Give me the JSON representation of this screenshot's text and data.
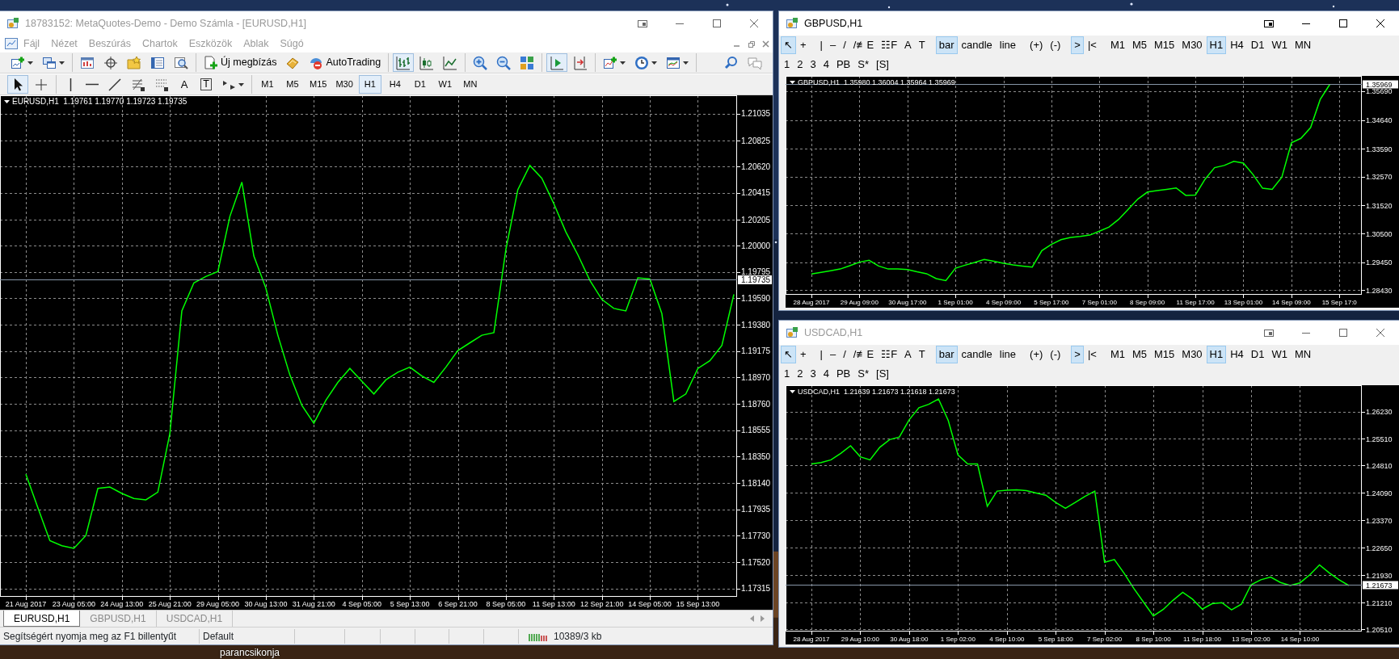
{
  "desktop": {
    "label": "parancsikonja"
  },
  "windows": [
    {
      "kind": "terminal",
      "title": "18783152: MetaQuotes-Demo - Demo Számla - [EURUSD,H1]",
      "active": false,
      "menu": [
        "Fájl",
        "Nézet",
        "Beszúrás",
        "Chartok",
        "Eszközök",
        "Ablak",
        "Súgó"
      ],
      "toolbar": {
        "groups": [
          [
            {
              "kind": "new-chart",
              "on": false,
              "dropdown": true
            },
            {
              "kind": "profiles",
              "on": false,
              "dropdown": true
            }
          ],
          [
            {
              "kind": "market-watch",
              "on": false,
              "dropdown": false
            },
            {
              "kind": "data-window",
              "on": false,
              "dropdown": false
            },
            {
              "kind": "navigator",
              "on": false,
              "dropdown": false
            },
            {
              "kind": "terminal",
              "on": false,
              "dropdown": false
            },
            {
              "kind": "tester",
              "on": false,
              "dropdown": false
            }
          ],
          [
            {
              "kind": "new-order",
              "label": "Új megbízás",
              "on": false,
              "dropdown": false
            },
            {
              "kind": "metaeditor",
              "on": false,
              "dropdown": false
            },
            {
              "kind": "autotrading",
              "label": "AutoTrading",
              "on": false,
              "dropdown": false
            }
          ],
          [
            {
              "kind": "bar-chart",
              "on": true,
              "dropdown": false
            },
            {
              "kind": "candle-chart",
              "on": false,
              "dropdown": false
            },
            {
              "kind": "line-chart",
              "on": false,
              "dropdown": false
            }
          ],
          [
            {
              "kind": "zoom-in",
              "on": false,
              "dropdown": false
            },
            {
              "kind": "zoom-out",
              "on": false,
              "dropdown": false
            },
            {
              "kind": "tile",
              "on": false,
              "dropdown": false
            }
          ],
          [
            {
              "kind": "auto-scroll",
              "on": true,
              "dropdown": false
            },
            {
              "kind": "chart-shift",
              "on": false,
              "dropdown": false
            }
          ],
          [
            {
              "kind": "indicators",
              "on": false,
              "dropdown": true
            },
            {
              "kind": "periods",
              "on": false,
              "dropdown": true
            },
            {
              "kind": "templates",
              "on": false,
              "dropdown": true
            }
          ]
        ],
        "right": [
          {
            "kind": "search",
            "on": false,
            "dropdown": false
          },
          {
            "kind": "chat",
            "on": false,
            "dropdown": false
          }
        ]
      },
      "drawing_tools": {
        "groups": [
          [
            {
              "kind": "cursor",
              "on": true,
              "dropdown": false
            },
            {
              "kind": "crosshair",
              "on": false,
              "dropdown": false
            }
          ],
          [
            {
              "kind": "vline",
              "on": false,
              "dropdown": false
            },
            {
              "kind": "hline",
              "on": false,
              "dropdown": false
            },
            {
              "kind": "trendline",
              "on": false,
              "dropdown": false
            },
            {
              "kind": "fibo-e",
              "on": false,
              "dropdown": false
            },
            {
              "kind": "fibo-f",
              "on": false,
              "dropdown": false
            },
            {
              "kind": "letter",
              "label": "A",
              "on": false,
              "dropdown": false
            },
            {
              "kind": "boxed-letter",
              "label": "T",
              "on": false,
              "dropdown": false
            },
            {
              "kind": "arrows",
              "on": false,
              "dropdown": true
            }
          ],
          [
            {
              "kind": "timeframe",
              "label": "M1",
              "on": false,
              "dropdown": false
            },
            {
              "kind": "timeframe",
              "label": "M5",
              "on": false,
              "dropdown": false
            },
            {
              "kind": "timeframe",
              "label": "M15",
              "on": false,
              "dropdown": false
            },
            {
              "kind": "timeframe",
              "label": "M30",
              "on": false,
              "dropdown": false
            },
            {
              "kind": "timeframe",
              "label": "H1",
              "on": true,
              "dropdown": false
            },
            {
              "kind": "timeframe",
              "label": "H4",
              "on": false,
              "dropdown": false
            },
            {
              "kind": "timeframe",
              "label": "D1",
              "on": false,
              "dropdown": false
            },
            {
              "kind": "timeframe",
              "label": "W1",
              "on": false,
              "dropdown": false
            },
            {
              "kind": "timeframe",
              "label": "MN",
              "on": false,
              "dropdown": false
            }
          ]
        ]
      },
      "chart": {
        "chart_data": {
          "type": "line",
          "title": "EURUSD,H1  1.19761 1.19770 1.19723 1.19735",
          "categories": [
            "21 Aug 2017",
            null,
            null,
            null,
            "23 Aug 05:00",
            null,
            null,
            null,
            "24 Aug 13:00",
            null,
            null,
            null,
            "25 Aug 21:00",
            null,
            null,
            null,
            "29 Aug 05:00",
            null,
            null,
            null,
            "30 Aug 13:00",
            null,
            null,
            null,
            "31 Aug 21:00",
            null,
            null,
            null,
            "4 Sep 05:00",
            null,
            null,
            null,
            "5 Sep 13:00",
            null,
            null,
            null,
            "6 Sep 21:00",
            null,
            null,
            null,
            "8 Sep 05:00",
            null,
            null,
            null,
            "11 Sep 13:00",
            null,
            null,
            null,
            "12 Sep 21:00",
            null,
            null,
            null,
            "14 Sep 05:00",
            null,
            null,
            null,
            "15 Sep 13:00",
            null,
            null,
            null
          ],
          "series": [
            {
              "color": "#00ff00",
              "values": [
                1.1821,
                1.1795,
                1.1769,
                1.1765,
                1.1763,
                1.1773,
                1.181,
                1.1811,
                1.1806,
                1.1802,
                1.1801,
                1.1807,
                1.1853,
                1.1949,
                1.1971,
                1.1976,
                1.198,
                1.2023,
                1.205,
                1.1992,
                1.1967,
                1.193,
                1.1899,
                1.1875,
                1.1861,
                1.1879,
                1.1893,
                1.1904,
                1.1894,
                1.1884,
                1.1895,
                1.1901,
                1.1905,
                1.1898,
                1.1893,
                1.1905,
                1.1918,
                1.1924,
                1.193,
                1.1932,
                1.1997,
                1.2044,
                1.2063,
                1.2053,
                1.2033,
                1.2011,
                1.1993,
                1.1973,
                1.1958,
                1.1951,
                1.1949,
                1.1975,
                1.1974,
                1.1947,
                1.1878,
                1.1884,
                1.1904,
                1.191,
                1.1922,
                1.1962
              ]
            }
          ],
          "grid": true,
          "ylim": [
            1.1725,
            1.2118
          ],
          "yticks": [
            {
              "value": 1.21035,
              "label": "1.21035"
            },
            {
              "value": 1.20825,
              "label": "1.20825"
            },
            {
              "value": 1.2062,
              "label": "1.20620"
            },
            {
              "value": 1.20415,
              "label": "1.20415"
            },
            {
              "value": 1.20205,
              "label": "1.20205"
            },
            {
              "value": 1.2,
              "label": "1.20000"
            },
            {
              "value": 1.19795,
              "label": "1.19795"
            },
            {
              "value": 1.1959,
              "label": "1.19590"
            },
            {
              "value": 1.1938,
              "label": "1.19380"
            },
            {
              "value": 1.19175,
              "label": "1.19175"
            },
            {
              "value": 1.1897,
              "label": "1.18970"
            },
            {
              "value": 1.1876,
              "label": "1.18760"
            },
            {
              "value": 1.18555,
              "label": "1.18555"
            },
            {
              "value": 1.1835,
              "label": "1.18350"
            },
            {
              "value": 1.1814,
              "label": "1.18140"
            },
            {
              "value": 1.17935,
              "label": "1.17935"
            },
            {
              "value": 1.1773,
              "label": "1.17730"
            },
            {
              "value": 1.1752,
              "label": "1.17520"
            },
            {
              "value": 1.17315,
              "label": "1.17315"
            }
          ],
          "ref_lines": [
            {
              "axis": "y",
              "value": 1.19735,
              "label": "1.19735",
              "color": "#8796a8"
            }
          ]
        }
      },
      "tabs": [
        {
          "label": "EURUSD,H1",
          "selected": true
        },
        {
          "label": "GBPUSD,H1",
          "selected": false
        },
        {
          "label": "USDCAD,H1",
          "selected": false
        }
      ],
      "status_bar": {
        "texts": [
          "Segítségért nyomja meg az F1 billentyűt",
          "Default"
        ],
        "traffic": "10389/3 kb"
      }
    },
    {
      "kind": "chart",
      "title": "GBPUSD,H1",
      "active": true,
      "toolbar": {
        "rows": [
          [
            [
              {
                "label": "↖",
                "on": true
              },
              {
                "label": "+",
                "on": false
              }
            ],
            [
              {
                "label": "|",
                "on": false
              },
              {
                "label": "–",
                "on": false
              },
              {
                "label": "/",
                "on": false
              },
              {
                "label": "/≢E",
                "on": false
              },
              {
                "label": "☷F",
                "on": false
              },
              {
                "label": "A",
                "on": false
              },
              {
                "label": "T",
                "on": false
              }
            ],
            [
              {
                "label": "bar",
                "on": true
              },
              {
                "label": "candle",
                "on": false
              },
              {
                "label": "line",
                "on": false
              }
            ],
            [
              {
                "label": "(+)",
                "on": false
              },
              {
                "label": "(-)",
                "on": false
              }
            ],
            [
              {
                "label": ">",
                "on": true
              },
              {
                "label": "|<",
                "on": false
              }
            ],
            [
              {
                "label": "M1",
                "on": false
              },
              {
                "label": "M5",
                "on": false
              },
              {
                "label": "M15",
                "on": false
              },
              {
                "label": "M30",
                "on": false
              },
              {
                "label": "H1",
                "on": true
              },
              {
                "label": "H4",
                "on": false
              },
              {
                "label": "D1",
                "on": false
              },
              {
                "label": "W1",
                "on": false
              },
              {
                "label": "MN",
                "on": false
              }
            ]
          ],
          [
            [
              {
                "label": "1",
                "on": false
              },
              {
                "label": "2",
                "on": false
              },
              {
                "label": "3",
                "on": false
              },
              {
                "label": "4",
                "on": false
              },
              {
                "label": "PB",
                "on": false
              },
              {
                "label": "S*",
                "on": false
              },
              {
                "label": "[S]",
                "on": false
              }
            ]
          ]
        ]
      },
      "chart": {
        "chart_data": {
          "type": "line",
          "title": "GBPUSD,H1  1.35980 1.36004 1.35964 1.35969",
          "categories": [
            "28 Aug 2017",
            null,
            null,
            null,
            null,
            "29 Aug 09:00",
            null,
            null,
            null,
            null,
            "30 Aug 17:00",
            null,
            null,
            null,
            null,
            "1 Sep 01:00",
            null,
            null,
            null,
            null,
            "4 Sep 09:00",
            null,
            null,
            null,
            null,
            "5 Sep 17:00",
            null,
            null,
            null,
            null,
            "7 Sep 01:00",
            null,
            null,
            null,
            null,
            "8 Sep 09:00",
            null,
            null,
            null,
            null,
            "11 Sep 17:00",
            null,
            null,
            null,
            null,
            "13 Sep 01:00",
            null,
            null,
            null,
            null,
            "14 Sep 09:00",
            null,
            null,
            null,
            null,
            "15 Sep 17:0",
            null,
            null
          ],
          "series": [
            {
              "color": "#00ff00",
              "values": [
                1.2902,
                1.2908,
                1.2914,
                1.292,
                1.2932,
                1.2945,
                1.2952,
                1.2931,
                1.292,
                1.292,
                1.2918,
                1.291,
                1.2903,
                1.2885,
                1.2878,
                1.2923,
                1.2934,
                1.2944,
                1.2955,
                1.2948,
                1.2941,
                1.2935,
                1.2931,
                1.2927,
                1.2987,
                1.301,
                1.3027,
                1.3035,
                1.3039,
                1.3044,
                1.3058,
                1.3073,
                1.3101,
                1.3138,
                1.3175,
                1.3201,
                1.3206,
                1.3211,
                1.3216,
                1.3189,
                1.319,
                1.3248,
                1.329,
                1.3298,
                1.3313,
                1.3307,
                1.3265,
                1.3215,
                1.3211,
                1.3255,
                1.3381,
                1.3397,
                1.3436,
                1.3539,
                1.3594,
                null,
                null,
                null
              ]
            }
          ],
          "grid": true,
          "ylim": [
            1.2826,
            1.3625
          ],
          "yticks": [
            {
              "value": 1.3569,
              "label": "1.35690"
            },
            {
              "value": 1.3464,
              "label": "1.34640"
            },
            {
              "value": 1.3359,
              "label": "1.33590"
            },
            {
              "value": 1.3257,
              "label": "1.32570"
            },
            {
              "value": 1.3152,
              "label": "1.31520"
            },
            {
              "value": 1.305,
              "label": "1.30500"
            },
            {
              "value": 1.2945,
              "label": "1.29450"
            },
            {
              "value": 1.2843,
              "label": "1.28430"
            }
          ],
          "ref_lines": [
            {
              "axis": "y",
              "value": 1.35969,
              "label": "1.35969",
              "color": "#8796a8"
            }
          ]
        }
      }
    },
    {
      "kind": "chart",
      "title": "USDCAD,H1",
      "active": false,
      "toolbar": {
        "rows": [
          [
            [
              {
                "label": "↖",
                "on": true
              },
              {
                "label": "+",
                "on": false
              }
            ],
            [
              {
                "label": "|",
                "on": false
              },
              {
                "label": "–",
                "on": false
              },
              {
                "label": "/",
                "on": false
              },
              {
                "label": "/≢E",
                "on": false
              },
              {
                "label": "☷F",
                "on": false
              },
              {
                "label": "A",
                "on": false
              },
              {
                "label": "T",
                "on": false
              }
            ],
            [
              {
                "label": "bar",
                "on": true
              },
              {
                "label": "candle",
                "on": false
              },
              {
                "label": "line",
                "on": false
              }
            ],
            [
              {
                "label": "(+)",
                "on": false
              },
              {
                "label": "(-)",
                "on": false
              }
            ],
            [
              {
                "label": ">",
                "on": true
              },
              {
                "label": "|<",
                "on": false
              }
            ],
            [
              {
                "label": "M1",
                "on": false
              },
              {
                "label": "M5",
                "on": false
              },
              {
                "label": "M15",
                "on": false
              },
              {
                "label": "M30",
                "on": false
              },
              {
                "label": "H1",
                "on": true
              },
              {
                "label": "H4",
                "on": false
              },
              {
                "label": "D1",
                "on": false
              },
              {
                "label": "W1",
                "on": false
              },
              {
                "label": "MN",
                "on": false
              }
            ]
          ],
          [
            [
              {
                "label": "1",
                "on": false
              },
              {
                "label": "2",
                "on": false
              },
              {
                "label": "3",
                "on": false
              },
              {
                "label": "4",
                "on": false
              },
              {
                "label": "PB",
                "on": false
              },
              {
                "label": "S*",
                "on": false
              },
              {
                "label": "[S]",
                "on": false
              }
            ]
          ]
        ]
      },
      "chart": {
        "chart_data": {
          "type": "line",
          "title": "USDCAD,H1  1.21639 1.21673 1.21618 1.21673",
          "categories": [
            "28 Aug 2017",
            null,
            null,
            null,
            null,
            "29 Aug 10:00",
            null,
            null,
            null,
            null,
            "30 Aug 18:00",
            null,
            null,
            null,
            null,
            "1 Sep 02:00",
            null,
            null,
            null,
            null,
            "4 Sep 10:00",
            null,
            null,
            null,
            null,
            "5 Sep 18:00",
            null,
            null,
            null,
            null,
            "7 Sep 02:00",
            null,
            null,
            null,
            null,
            "8 Sep 10:00",
            null,
            null,
            null,
            null,
            "11 Sep 18:00",
            null,
            null,
            null,
            null,
            "13 Sep 02:00",
            null,
            null,
            null,
            null,
            "14 Sep 10:00",
            null,
            null,
            null,
            null,
            null,
            null
          ],
          "series": [
            {
              "color": "#00ff00",
              "values": [
                1.2485,
                1.2489,
                1.2496,
                1.2513,
                1.2533,
                1.2504,
                1.2496,
                1.2529,
                1.2549,
                1.2556,
                1.2601,
                1.2633,
                1.2642,
                1.2656,
                1.2599,
                1.2509,
                1.2485,
                1.2485,
                1.2374,
                1.2414,
                1.2416,
                1.2417,
                1.2415,
                1.2409,
                1.2403,
                1.2384,
                1.2369,
                1.2384,
                1.24,
                1.2414,
                1.2227,
                1.2234,
                1.2198,
                1.2158,
                1.2122,
                1.2086,
                1.2103,
                1.2127,
                1.2148,
                1.213,
                1.2104,
                1.2118,
                1.2121,
                1.2102,
                1.2117,
                1.2168,
                1.2181,
                1.2188,
                1.2174,
                1.2166,
                1.2173,
                1.2194,
                1.222,
                1.2199,
                1.2181,
                1.2166,
                null
              ]
            }
          ],
          "grid": true,
          "ylim": [
            1.2045,
            1.2692
          ],
          "yticks": [
            {
              "value": 1.2623,
              "label": "1.26230"
            },
            {
              "value": 1.2551,
              "label": "1.25510"
            },
            {
              "value": 1.2481,
              "label": "1.24810"
            },
            {
              "value": 1.2409,
              "label": "1.24090"
            },
            {
              "value": 1.2337,
              "label": "1.23370"
            },
            {
              "value": 1.2265,
              "label": "1.22650"
            },
            {
              "value": 1.2193,
              "label": "1.21930"
            },
            {
              "value": 1.2121,
              "label": "1.21210"
            },
            {
              "value": 1.2051,
              "label": "1.20510"
            }
          ],
          "ref_lines": [
            {
              "axis": "y",
              "value": 1.21673,
              "label": "1.21673",
              "color": "#8796a8"
            }
          ]
        }
      }
    }
  ]
}
